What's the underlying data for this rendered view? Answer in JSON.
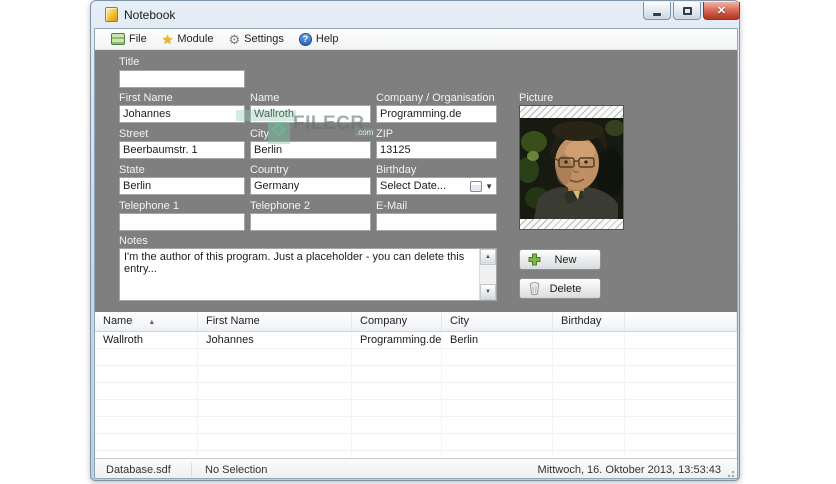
{
  "window": {
    "title": "Notebook",
    "controls": {
      "minimize": "minimize",
      "maximize": "maximize",
      "close": "close"
    }
  },
  "menubar": {
    "items": [
      {
        "label": "File",
        "icon": "file-icon"
      },
      {
        "label": "Module",
        "icon": "star-icon"
      },
      {
        "label": "Settings",
        "icon": "gear-icon"
      },
      {
        "label": "Help",
        "icon": "help-icon"
      }
    ]
  },
  "form": {
    "fields": {
      "title": {
        "label": "Title",
        "value": ""
      },
      "first_name": {
        "label": "First Name",
        "value": "Johannes"
      },
      "name": {
        "label": "Name",
        "value": "Wallroth"
      },
      "company": {
        "label": "Company / Organisation",
        "value": "Programming.de"
      },
      "street": {
        "label": "Street",
        "value": "Beerbaumstr. 1"
      },
      "city": {
        "label": "City",
        "value": "Berlin"
      },
      "zip": {
        "label": "ZIP",
        "value": "13125"
      },
      "state": {
        "label": "State",
        "value": "Berlin"
      },
      "country": {
        "label": "Country",
        "value": "Germany"
      },
      "birthday": {
        "label": "Birthday",
        "value": "Select Date..."
      },
      "telephone1": {
        "label": "Telephone 1",
        "value": ""
      },
      "telephone2": {
        "label": "Telephone 2",
        "value": ""
      },
      "email": {
        "label": "E-Mail",
        "value": ""
      },
      "notes": {
        "label": "Notes",
        "value": "I'm the author of this program. Just a placeholder - you can delete this entry..."
      }
    },
    "picture_label": "Picture",
    "buttons": {
      "new": "New",
      "delete": "Delete"
    }
  },
  "table": {
    "columns": [
      "Name",
      "First Name",
      "Company",
      "City",
      "Birthday",
      ""
    ],
    "sorted_column": "Name",
    "sort_direction": "ascending",
    "rows": [
      [
        "Wallroth",
        "Johannes",
        "Programming.de",
        "Berlin",
        "",
        ""
      ]
    ],
    "empty_row_count": 7
  },
  "statusbar": {
    "database": "Database.sdf",
    "selection": "No Selection",
    "datetime": "Mittwoch, 16. Oktober 2013, 13:53:43"
  },
  "watermark": {
    "text": "FILECR",
    "suffix": ".com"
  },
  "colors": {
    "panel_gray": "#7f7f7f",
    "close_red": "#b83c28",
    "new_icon_green": "#7ab648",
    "star_gold": "#f2b718",
    "help_blue": "#2a62b4"
  }
}
